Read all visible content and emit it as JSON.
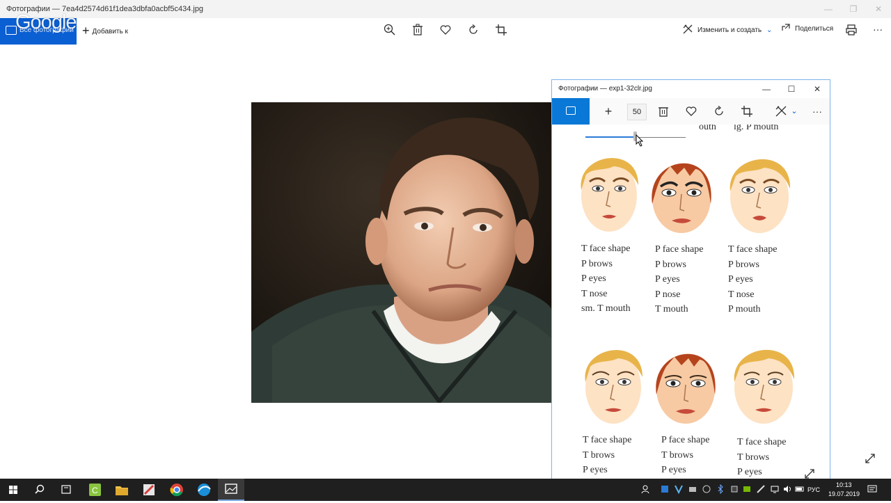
{
  "main_window": {
    "title": "Фотографии — 7ea4d2574d61f1dea3dbfa0acbf5c434.jpg",
    "minimize": "—",
    "maximize": "❐",
    "close": "✕"
  },
  "toolbar": {
    "all_photos_label": "Все фотографии",
    "overlay_logo": "Google",
    "add_label": "Добавить к",
    "edit_label": "Изменить и создать",
    "share_label": "Поделиться",
    "more": "···"
  },
  "photo": {
    "icon": "person-portrait-image"
  },
  "secondary_window": {
    "title": "Фотографии — exp1-32clr.jpg",
    "minimize": "—",
    "maximize": "☐",
    "close": "✕",
    "zoom_value": "50",
    "more": "···",
    "zoom_slider_level": 0.5,
    "top_captions": [
      "outh",
      "lg. P mouth"
    ],
    "faces_row1": [
      {
        "hair": "#e8b44a",
        "labels": [
          "T face shape",
          "P brows",
          "P eyes",
          "T nose",
          "sm. T mouth"
        ]
      },
      {
        "hair": "#b5441d",
        "labels": [
          "P face shape",
          "P brows",
          "P eyes",
          "P nose",
          "T mouth"
        ]
      },
      {
        "hair": "#e8b44a",
        "labels": [
          "T face shape",
          "P brows",
          "P eyes",
          "T nose",
          "P mouth"
        ]
      }
    ],
    "faces_row2": [
      {
        "hair": "#e8b44a",
        "labels": [
          "T face shape",
          "T brows",
          "P eyes"
        ]
      },
      {
        "hair": "#b5441d",
        "labels": [
          "P face shape",
          "T brows",
          "P eyes"
        ]
      },
      {
        "hair": "#e8b44a",
        "labels": [
          "T face shape",
          "T brows",
          "P eyes"
        ]
      }
    ]
  },
  "taskbar": {
    "lang": "РУС",
    "time": "10:13",
    "date": "19.07.2019"
  },
  "colors": {
    "accent": "#0a5fd3",
    "accent2": "#0a78d7",
    "taskbar": "#1f1f1f"
  }
}
